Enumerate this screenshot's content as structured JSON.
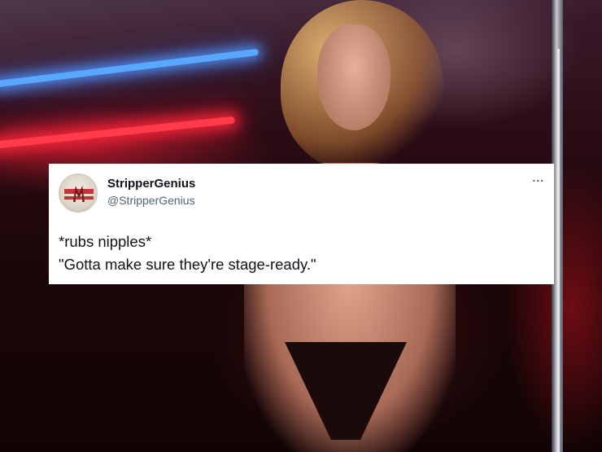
{
  "tweet": {
    "display_name": "StripperGenius",
    "handle": "@StripperGenius",
    "more_glyph": "...",
    "avatar_icon": "logo-badge-icon",
    "lines": [
      "*rubs nipples*",
      "\"Gotta make sure they're stage-ready.\""
    ]
  },
  "colors": {
    "card_background": "#ffffff",
    "text_primary": "#0f1419",
    "text_secondary": "#536471",
    "neon_blue": "#58a8ff",
    "neon_red": "#ff3a4a"
  }
}
